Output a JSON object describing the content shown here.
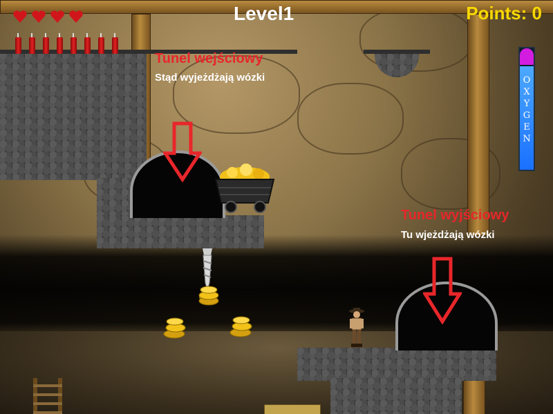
{
  "hud": {
    "title": "Level1",
    "points_label": "Points:",
    "points_value": "0",
    "lives": 4,
    "dynamite": 8,
    "oxygen_letters": "OXYGEN",
    "oxygen_level": 0.85
  },
  "labels": {
    "entry_tunnel_title": "Tunel wejściowy",
    "entry_tunnel_sub": "Stąd wyjeżdżają wózki",
    "exit_tunnel_title": "Tunel wyjściowy",
    "exit_tunnel_sub": "Tu wjeżdżają wózki"
  },
  "colors": {
    "label_red": "#e8262a",
    "points": "#f7d800",
    "oxygen_fill": "#1a70ff",
    "oxygen_top": "#d21de0",
    "heart": "#d0161b"
  }
}
